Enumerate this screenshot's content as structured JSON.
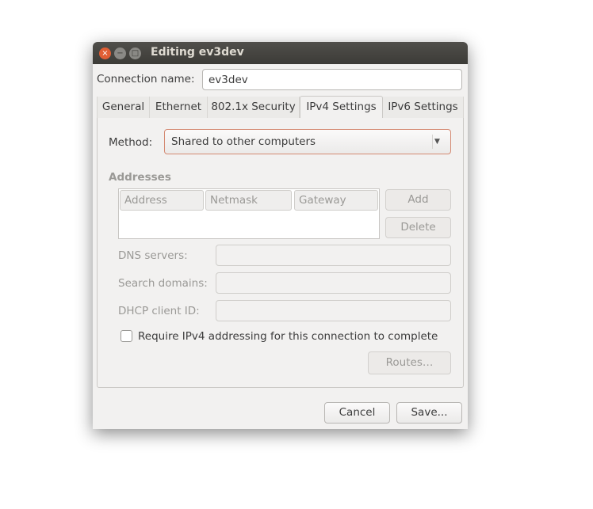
{
  "window": {
    "title": "Editing ev3dev",
    "close_icon": "×",
    "minimize_icon": "−",
    "maximize_icon": "□"
  },
  "connection_name": {
    "label": "Connection name:",
    "value": "ev3dev"
  },
  "tabs": [
    {
      "label": "General"
    },
    {
      "label": "Ethernet"
    },
    {
      "label": "802.1x Security"
    },
    {
      "label": "IPv4 Settings",
      "active": true
    },
    {
      "label": "IPv6 Settings"
    }
  ],
  "ipv4": {
    "method_label": "Method:",
    "method_value": "Shared to other computers",
    "addresses_label": "Addresses",
    "columns": [
      "Address",
      "Netmask",
      "Gateway"
    ],
    "add_label": "Add",
    "delete_label": "Delete",
    "dns_label": "DNS servers:",
    "dns_value": "",
    "search_label": "Search domains:",
    "search_value": "",
    "dhcp_label": "DHCP client ID:",
    "dhcp_value": "",
    "require_label": "Require IPv4 addressing for this connection to complete",
    "require_checked": false,
    "routes_label": "Routes…"
  },
  "footer": {
    "cancel_label": "Cancel",
    "save_label": "Save..."
  },
  "colors": {
    "titlebar": "#3c3b37",
    "close": "#e05e34",
    "focus_border": "#d48a72"
  }
}
